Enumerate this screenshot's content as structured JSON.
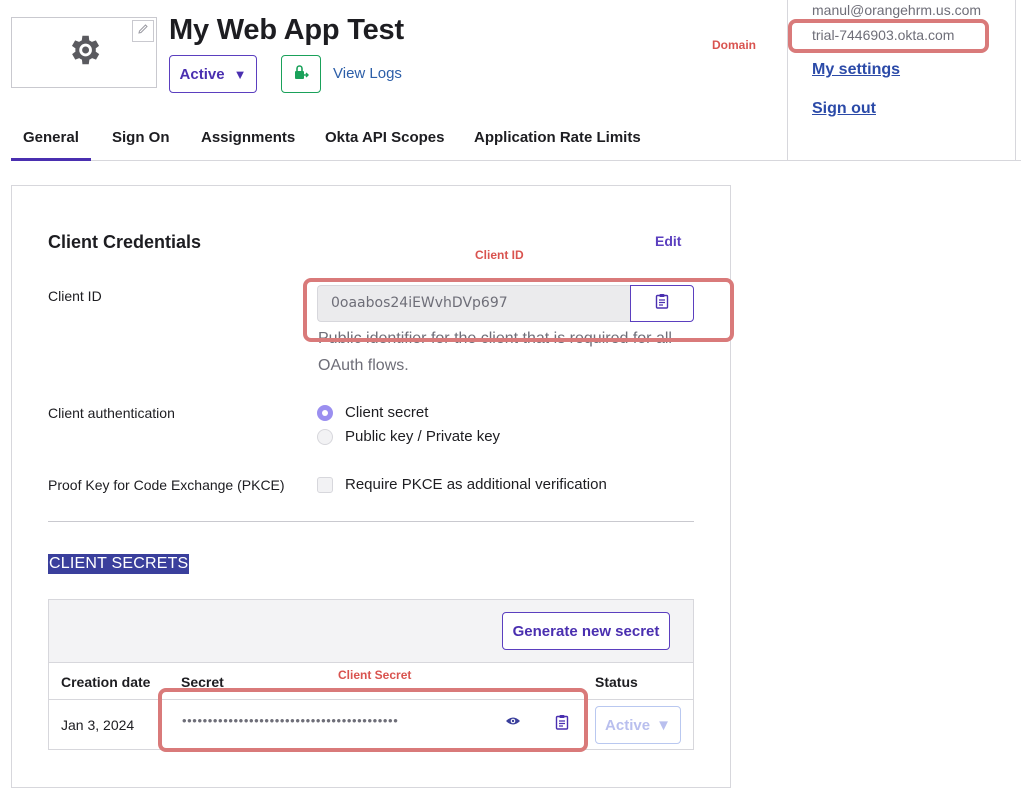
{
  "header": {
    "app_title": "My Web App Test",
    "status_label": "Active",
    "status_caret": "▼",
    "view_logs": "View Logs",
    "icons": {
      "logo": "gear-icon",
      "edit": "pencil-icon",
      "push": "lock-push-icon"
    }
  },
  "account_menu": {
    "email": "manul@orangehrm.us.com",
    "domain": "trial-7446903.okta.com",
    "my_settings": "My settings",
    "sign_out": "Sign out"
  },
  "tabs": [
    {
      "label": "General",
      "active": true
    },
    {
      "label": "Sign On",
      "active": false
    },
    {
      "label": "Assignments",
      "active": false
    },
    {
      "label": "Okta API Scopes",
      "active": false
    },
    {
      "label": "Application Rate Limits",
      "active": false
    }
  ],
  "credentials": {
    "title": "Client Credentials",
    "edit": "Edit",
    "client_id_label": "Client ID",
    "client_id_value": "0oaabos24iEWvhDVp697",
    "client_id_help": "Public identifier for the client that is required for all OAuth flows.",
    "client_auth_label": "Client authentication",
    "auth_options": [
      {
        "label": "Client secret",
        "selected": true
      },
      {
        "label": "Public key / Private key",
        "selected": false
      }
    ],
    "pkce_label": "Proof Key for Code Exchange (PKCE)",
    "pkce_option": "Require PKCE as additional verification",
    "pkce_checked": false
  },
  "secrets": {
    "heading": "CLIENT SECRETS",
    "generate_button": "Generate new secret",
    "columns": [
      "Creation date",
      "Secret",
      "Status"
    ],
    "rows": [
      {
        "creation_date": "Jan 3, 2024",
        "secret_masked": "••••••••••••••••••••••••••••••••••••••••••",
        "status": "Active",
        "status_caret": "▼"
      }
    ]
  },
  "annotations": {
    "domain": "Domain",
    "client_id": "Client ID",
    "client_secret": "Client Secret"
  },
  "colors": {
    "brand_purple": "#4a2fb0",
    "link_blue": "#2b4aa8",
    "push_green": "#1aa15a",
    "annotation_red": "#d97a7a",
    "secrets_heading_bg": "#3a3f9c"
  }
}
